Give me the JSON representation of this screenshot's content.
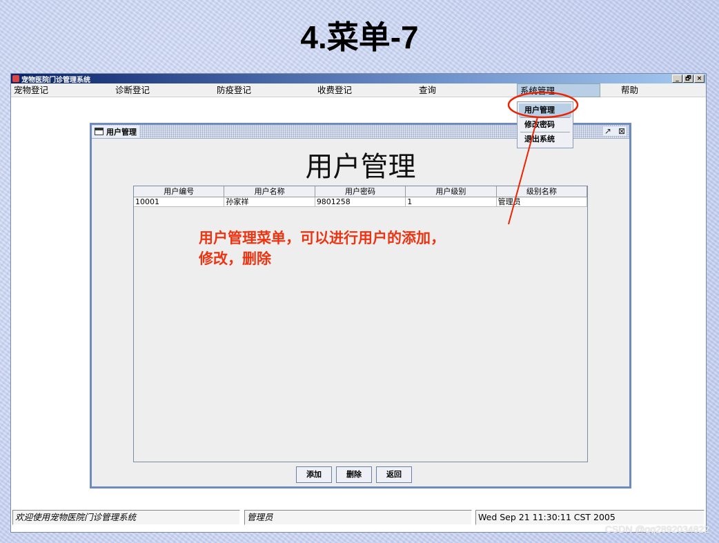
{
  "slide": {
    "title": "4.菜单-7",
    "watermark": "CSDN @qq2892034822"
  },
  "app": {
    "title": "宠物医院门诊管理系统",
    "window_controls": [
      "_",
      "🗗",
      "×"
    ]
  },
  "menubar": {
    "items": [
      {
        "label": "宠物登记"
      },
      {
        "label": "诊断登记"
      },
      {
        "label": "防疫登记"
      },
      {
        "label": "收费登记"
      },
      {
        "label": "查询"
      },
      {
        "label": "系统管理"
      },
      {
        "label": "帮助"
      }
    ],
    "active": "系统管理",
    "dropdown": [
      {
        "label": "用户管理"
      },
      {
        "label": "修改密码"
      },
      {
        "label": "退出系统"
      }
    ]
  },
  "internal_frame": {
    "title": "用户管理",
    "heading": "用户管理",
    "table": {
      "columns": [
        "用户编号",
        "用户名称",
        "用户密码",
        "用户级别",
        "级别名称"
      ],
      "rows": [
        [
          "10001",
          "孙家祥",
          "9801258",
          "1",
          "管理员"
        ]
      ]
    },
    "buttons": {
      "add": "添加",
      "delete": "删除",
      "back": "返回"
    }
  },
  "statusbar": {
    "welcome": "欢迎使用宠物医院门诊管理系统",
    "user": "管理员",
    "datetime": "Wed Sep 21 11:30:11 CST 2005"
  },
  "annotation": {
    "line1": "用户管理菜单，可以进行用户的添加，",
    "line2": "修改，删除",
    "color": "#ee3311"
  }
}
